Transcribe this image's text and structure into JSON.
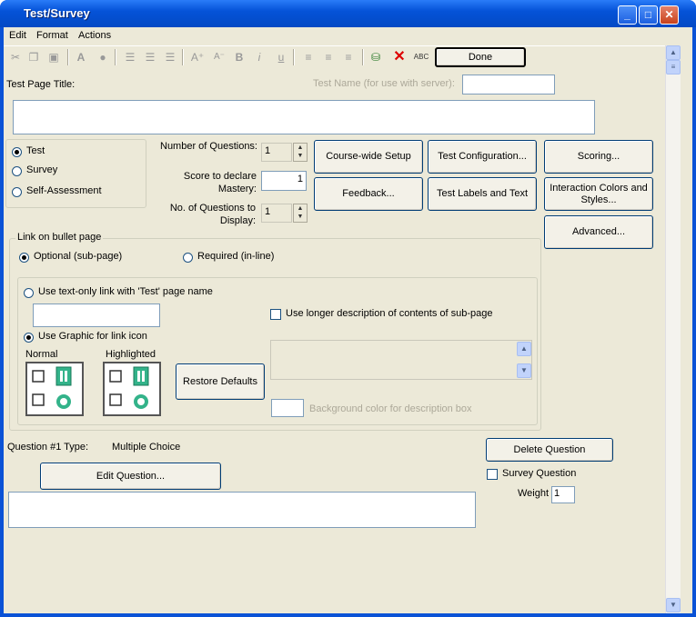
{
  "window": {
    "title": "Test/Survey",
    "minimize": "_",
    "maximize": "□",
    "close": "✕"
  },
  "menu": [
    "Edit",
    "Format",
    "Actions"
  ],
  "toolbar": {
    "done_label": "Done"
  },
  "page_title_label": "Test Page Title:",
  "test_name_label": "Test Name (for use with server):",
  "test_name_value": "",
  "page_title_value": "",
  "type_options": [
    "Test",
    "Survey",
    "Self-Assessment"
  ],
  "selected_type": "Test",
  "num_questions_label": "Number of Questions:",
  "num_questions_value": "1",
  "mastery_label": "Score to declare Mastery:",
  "mastery_value": "1",
  "display_label": "No. of Questions to Display:",
  "display_value": "1",
  "buttons": {
    "course_setup": "Course-wide Setup",
    "test_config": "Test Configuration...",
    "scoring": "Scoring...",
    "feedback": "Feedback...",
    "labels": "Test Labels and Text",
    "interaction": "Interaction Colors and Styles...",
    "advanced": "Advanced...",
    "restore": "Restore Defaults",
    "delete_q": "Delete Question",
    "edit_q": "Edit Question..."
  },
  "link_group": {
    "title": "Link on bullet page",
    "optional": "Optional (sub-page)",
    "required": "Required (in-line)",
    "text_only": "Use text-only link with 'Test' page name",
    "graphic": "Use Graphic for link icon",
    "normal": "Normal",
    "highlighted": "Highlighted",
    "longer_desc": "Use longer description of contents of sub-page",
    "bg_color": "Background color for description box"
  },
  "question": {
    "type_label": "Question #1 Type:",
    "type_value": "Multiple Choice",
    "survey_label": "Survey Question",
    "weight_label": "Weight",
    "weight_value": "1"
  }
}
